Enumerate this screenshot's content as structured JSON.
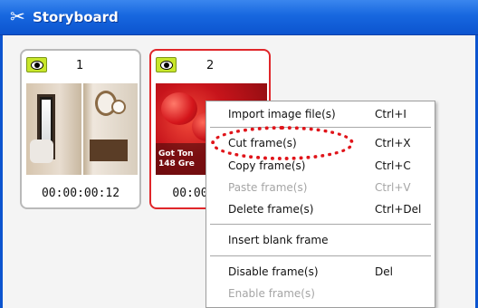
{
  "window": {
    "title": "Storyboard",
    "title_icon": "scissors-icon"
  },
  "frames": [
    {
      "number": "1",
      "timecode": "00:00:00:12",
      "visible_icon": "eye-icon",
      "selected": false
    },
    {
      "number": "2",
      "timecode": "00:00",
      "visible_icon": "eye-icon",
      "selected": true,
      "thumbnail_caption_1": "Got Ton",
      "thumbnail_caption_2": "148 Gre"
    }
  ],
  "context_menu": {
    "items": [
      {
        "label": "Import image file(s)",
        "shortcut": "Ctrl+I",
        "enabled": true
      },
      {
        "label": "Cut frame(s)",
        "shortcut": "Ctrl+X",
        "enabled": true,
        "highlighted": true
      },
      {
        "label": "Copy frame(s)",
        "shortcut": "Ctrl+C",
        "enabled": true
      },
      {
        "label": "Paste frame(s)",
        "shortcut": "Ctrl+V",
        "enabled": false
      },
      {
        "label": "Delete frame(s)",
        "shortcut": "Ctrl+Del",
        "enabled": true
      },
      {
        "label": "Insert blank frame",
        "shortcut": "",
        "enabled": true
      },
      {
        "label": "Disable frame(s)",
        "shortcut": "Del",
        "enabled": true
      },
      {
        "label": "Enable frame(s)",
        "shortcut": "",
        "enabled": false
      }
    ]
  },
  "colors": {
    "titlebar": "#1767df",
    "selected_border": "#e0262a",
    "highlight_mark": "#e0141a",
    "eye_badge": "#c8e62a"
  }
}
